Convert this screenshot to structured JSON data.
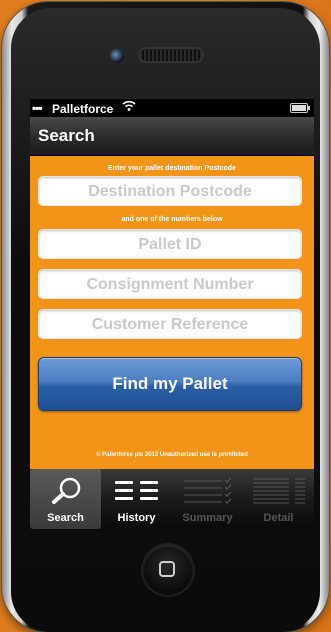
{
  "status": {
    "signal": "▪▪▪",
    "carrier": "Palletforce"
  },
  "navbar": {
    "title": "Search"
  },
  "form": {
    "hint_postcode": "Enter your pallet destination Postcode",
    "destination_placeholder": "Destination Postcode",
    "hint_numbers": "and one of the numbers below",
    "pallet_id_placeholder": "Pallet ID",
    "consignment_placeholder": "Consignment Number",
    "customer_ref_placeholder": "Customer Reference",
    "find_button": "Find my Pallet",
    "footer": "© Palletforce plc 2012 Unauthorized use is prohibited"
  },
  "tabs": [
    {
      "label": "Search",
      "icon": "search-icon",
      "selected": true,
      "enabled": true
    },
    {
      "label": "History",
      "icon": "list-icon",
      "selected": false,
      "enabled": true
    },
    {
      "label": "Summary",
      "icon": "checklist-icon",
      "selected": false,
      "enabled": false
    },
    {
      "label": "Detail",
      "icon": "detail-icon",
      "selected": false,
      "enabled": false
    }
  ],
  "colors": {
    "background": "#ec8a25",
    "content": "#f29418",
    "button": "#2b5ea6",
    "navbar": "#2c2c2c"
  }
}
